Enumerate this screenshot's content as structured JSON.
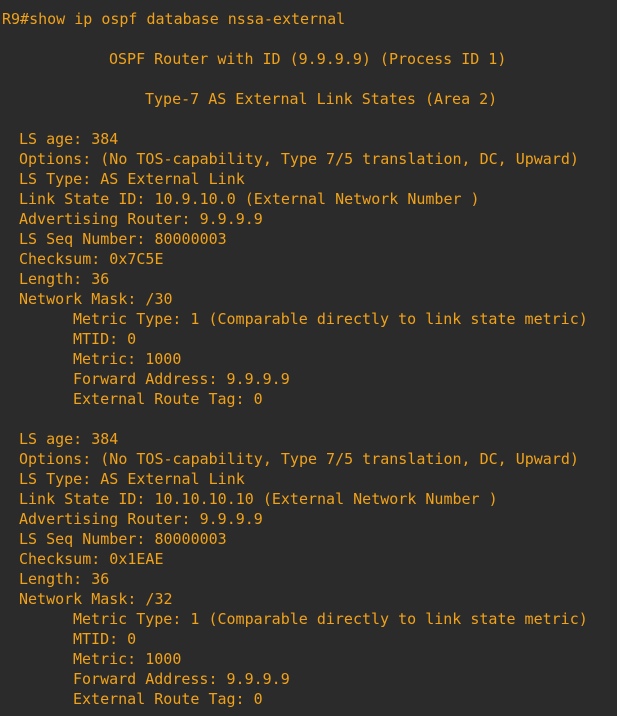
{
  "terminal": {
    "command": "R9#show ip ospf database nssa-external",
    "header_router": "OSPF Router with ID (9.9.9.9) (Process ID 1)",
    "header_type": "Type-7 AS External Link States (Area 2)",
    "entries": [
      {
        "ls_age": "LS age: 384",
        "options": "Options: (No TOS-capability, Type 7/5 translation, DC, Upward)",
        "ls_type": "LS Type: AS External Link",
        "link_state_id": "Link State ID: 10.9.10.0 (External Network Number )",
        "adv_router": "Advertising Router: 9.9.9.9",
        "seq": "LS Seq Number: 80000003",
        "checksum": "Checksum: 0x7C5E",
        "length": "Length: 36",
        "mask": "Network Mask: /30",
        "metric_type": "Metric Type: 1 (Comparable directly to link state metric)",
        "mtid": "MTID: 0",
        "metric": "Metric: 1000",
        "forward": "Forward Address: 9.9.9.9",
        "tag": "External Route Tag: 0"
      },
      {
        "ls_age": "LS age: 384",
        "options": "Options: (No TOS-capability, Type 7/5 translation, DC, Upward)",
        "ls_type": "LS Type: AS External Link",
        "link_state_id": "Link State ID: 10.10.10.10 (External Network Number )",
        "adv_router": "Advertising Router: 9.9.9.9",
        "seq": "LS Seq Number: 80000003",
        "checksum": "Checksum: 0x1EAE",
        "length": "Length: 36",
        "mask": "Network Mask: /32",
        "metric_type": "Metric Type: 1 (Comparable directly to link state metric)",
        "mtid": "MTID: 0",
        "metric": "Metric: 1000",
        "forward": "Forward Address: 9.9.9.9",
        "tag": "External Route Tag: 0"
      }
    ]
  },
  "colors": {
    "background": "#2b2b2b",
    "text": "#f0a21a"
  }
}
